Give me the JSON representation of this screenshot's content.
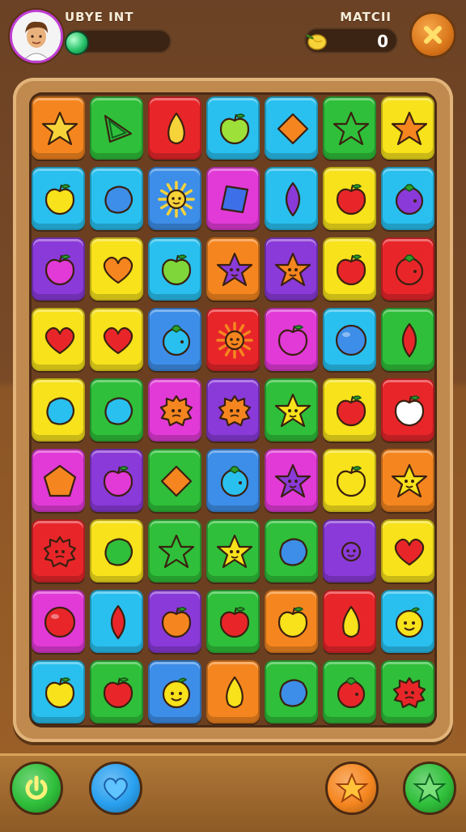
{
  "header": {
    "left_title": "UBYE INT",
    "right_title": "MATCII",
    "progress": 0.05,
    "score": "0"
  },
  "colors": {
    "orange": "#f5861f",
    "green": "#2fbf3a",
    "red": "#e8262a",
    "cyan": "#29c0ef",
    "blue": "#3d8ee8",
    "yellow": "#f7e21b",
    "purple": "#8a3ad8",
    "magenta": "#e13ad6"
  },
  "board": {
    "rows": 9,
    "cols": 7,
    "tiles": [
      [
        {
          "bg": "orange",
          "icon": "star"
        },
        {
          "bg": "green",
          "icon": "triangle"
        },
        {
          "bg": "red",
          "icon": "drop"
        },
        {
          "bg": "cyan",
          "icon": "apple"
        },
        {
          "bg": "cyan",
          "icon": "diamond"
        },
        {
          "bg": "green",
          "icon": "star"
        },
        {
          "bg": "yellow",
          "icon": "star"
        }
      ],
      [
        {
          "bg": "cyan",
          "icon": "apple"
        },
        {
          "bg": "cyan",
          "icon": "blob"
        },
        {
          "bg": "blue",
          "icon": "sun"
        },
        {
          "bg": "magenta",
          "icon": "gem"
        },
        {
          "bg": "cyan",
          "icon": "leaf"
        },
        {
          "bg": "yellow",
          "icon": "apple"
        },
        {
          "bg": "cyan",
          "icon": "berry"
        }
      ],
      [
        {
          "bg": "purple",
          "icon": "apple"
        },
        {
          "bg": "yellow",
          "icon": "heart"
        },
        {
          "bg": "cyan",
          "icon": "apple"
        },
        {
          "bg": "orange",
          "icon": "star-face"
        },
        {
          "bg": "purple",
          "icon": "star-face"
        },
        {
          "bg": "yellow",
          "icon": "apple"
        },
        {
          "bg": "red",
          "icon": "berry"
        }
      ],
      [
        {
          "bg": "yellow",
          "icon": "heart"
        },
        {
          "bg": "yellow",
          "icon": "heart"
        },
        {
          "bg": "blue",
          "icon": "berry"
        },
        {
          "bg": "red",
          "icon": "sun"
        },
        {
          "bg": "magenta",
          "icon": "apple"
        },
        {
          "bg": "cyan",
          "icon": "ball"
        },
        {
          "bg": "green",
          "icon": "leaf"
        }
      ],
      [
        {
          "bg": "yellow",
          "icon": "blob"
        },
        {
          "bg": "green",
          "icon": "blob"
        },
        {
          "bg": "magenta",
          "icon": "splat"
        },
        {
          "bg": "purple",
          "icon": "splat"
        },
        {
          "bg": "green",
          "icon": "star-face"
        },
        {
          "bg": "yellow",
          "icon": "apple"
        },
        {
          "bg": "red",
          "icon": "apple"
        }
      ],
      [
        {
          "bg": "magenta",
          "icon": "pentagon"
        },
        {
          "bg": "purple",
          "icon": "apple"
        },
        {
          "bg": "green",
          "icon": "diamond"
        },
        {
          "bg": "blue",
          "icon": "berry"
        },
        {
          "bg": "magenta",
          "icon": "star-face"
        },
        {
          "bg": "yellow",
          "icon": "apple"
        },
        {
          "bg": "orange",
          "icon": "star-face"
        }
      ],
      [
        {
          "bg": "red",
          "icon": "splat"
        },
        {
          "bg": "yellow",
          "icon": "blob"
        },
        {
          "bg": "green",
          "icon": "star"
        },
        {
          "bg": "green",
          "icon": "star-face"
        },
        {
          "bg": "green",
          "icon": "blob"
        },
        {
          "bg": "purple",
          "icon": "sun"
        },
        {
          "bg": "yellow",
          "icon": "heart"
        }
      ],
      [
        {
          "bg": "magenta",
          "icon": "ball"
        },
        {
          "bg": "cyan",
          "icon": "leaf"
        },
        {
          "bg": "purple",
          "icon": "apple"
        },
        {
          "bg": "green",
          "icon": "apple"
        },
        {
          "bg": "orange",
          "icon": "apple"
        },
        {
          "bg": "red",
          "icon": "drop"
        },
        {
          "bg": "cyan",
          "icon": "face"
        }
      ],
      [
        {
          "bg": "cyan",
          "icon": "apple"
        },
        {
          "bg": "green",
          "icon": "apple"
        },
        {
          "bg": "blue",
          "icon": "face"
        },
        {
          "bg": "orange",
          "icon": "drop"
        },
        {
          "bg": "green",
          "icon": "blob"
        },
        {
          "bg": "green",
          "icon": "berry"
        },
        {
          "bg": "green",
          "icon": "splat"
        }
      ]
    ],
    "icon_colors": [
      [
        "#f7d33a",
        "#2fbf3a",
        "#f7d33a",
        "#9de03a",
        "#f5861f",
        "#2fbf3a",
        "#f5861f"
      ],
      [
        "#f7e21b",
        "#3d8ee8",
        "#f7d33a",
        "#3d6fe8",
        "#8a3ad8",
        "#e8262a",
        "#8a3ad8"
      ],
      [
        "#e13ad6",
        "#f5861f",
        "#7ed63a",
        "#8a3ad8",
        "#f5861f",
        "#e8262a",
        "#e8262a"
      ],
      [
        "#e8262a",
        "#e8262a",
        "#29c0ef",
        "#f5861f",
        "#e13ad6",
        "#3d8ee8",
        "#e8262a"
      ],
      [
        "#29c0ef",
        "#29c0ef",
        "#f5861f",
        "#f5861f",
        "#f7e21b",
        "#e8262a",
        "#ffffff"
      ],
      [
        "#f5861f",
        "#e13ad6",
        "#f5861f",
        "#29c0ef",
        "#8a3ad8",
        "#f7e21b",
        "#f7e21b"
      ],
      [
        "#e8262a",
        "#2fbf3a",
        "#2fbf3a",
        "#f7e21b",
        "#3d8ee8",
        "#8a3ad8",
        "#e8262a"
      ],
      [
        "#e8262a",
        "#e8262a",
        "#f5861f",
        "#e8262a",
        "#f7e21b",
        "#f7e21b",
        "#f7e21b"
      ],
      [
        "#f7e21b",
        "#e8262a",
        "#f7e21b",
        "#f7e21b",
        "#3d8ee8",
        "#e8262a",
        "#e8262a"
      ]
    ]
  },
  "bottom_buttons": [
    {
      "name": "power-button",
      "icon": "power-icon",
      "color": "#2fbf3a"
    },
    {
      "name": "heart-button",
      "icon": "heart-icon",
      "color": "#29a0ef"
    },
    {
      "name": "star-button",
      "icon": "star-icon",
      "color": "#f5861f"
    },
    {
      "name": "green-star-button",
      "icon": "star-icon",
      "color": "#2fbf3a"
    }
  ]
}
